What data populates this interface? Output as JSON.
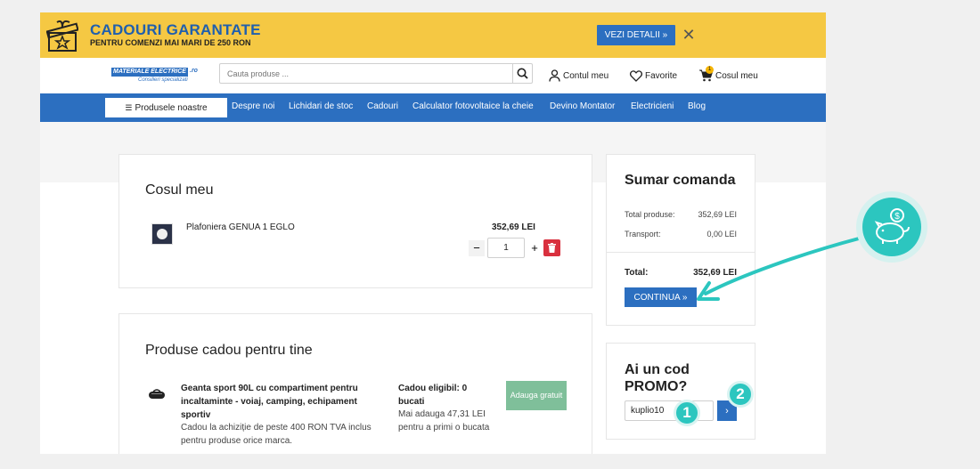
{
  "banner": {
    "title": "CADOURI GARANTATE",
    "subtitle": "PENTRU COMENZI MAI MARI DE 250 RON",
    "details_label": "VEZI DETALII »",
    "close_glyph": "✕"
  },
  "header": {
    "logo_text": "MATERIALE ELECTRICE",
    "logo_domain": ".ro",
    "logo_tagline": "Consilieri specializati",
    "search_placeholder": "Cauta produse ...",
    "account_label": "Contul meu",
    "favorites_label": "Favorite",
    "cart_label": "Cosul meu",
    "cart_count": "1"
  },
  "nav": {
    "products_label": "Produsele noastre",
    "items": [
      "Despre noi",
      "Lichidari de stoc",
      "Cadouri",
      "Calculator fotovoltaice la cheie",
      "Devino Montator",
      "Electricieni",
      "Blog"
    ]
  },
  "cart": {
    "title": "Cosul meu",
    "item": {
      "name": "Plafoniera GENUA 1 EGLO",
      "price": "352,69 LEI",
      "quantity": "1",
      "minus": "−",
      "plus": "+"
    }
  },
  "gifts": {
    "title": "Produse cadou pentru tine",
    "item": {
      "name": "Geanta sport 90L cu compartiment pentru incaltaminte - voiaj, camping, echipament sportiv",
      "description": "Cadou la achiziție de peste 400 RON TVA inclus pentru produse orice marca.",
      "eligible": "Cadou eligibil: 0 bucati",
      "more_needed": "Mai adauga 47,31 LEI pentru a primi o bucata",
      "button_label": "Adauga gratuit"
    }
  },
  "summary": {
    "title": "Sumar comanda",
    "rows": [
      {
        "label": "Total produse:",
        "value": "352,69 LEI"
      },
      {
        "label": "Transport:",
        "value": "0,00 LEI"
      }
    ],
    "total_label": "Total:",
    "total_value": "352,69 LEI",
    "continue_label": "CONTINUA »"
  },
  "promo": {
    "title": "Ai un cod PROMO?",
    "code_value": "kuplio10",
    "submit_glyph": "›"
  },
  "annotations": {
    "step1": "1",
    "step2": "2",
    "accent_color": "#2cc6bf"
  },
  "colors": {
    "brand_blue": "#2c6fc0",
    "banner_yellow": "#f5c843",
    "delete_red": "#d9303e",
    "gift_green": "#7fbf9a"
  }
}
